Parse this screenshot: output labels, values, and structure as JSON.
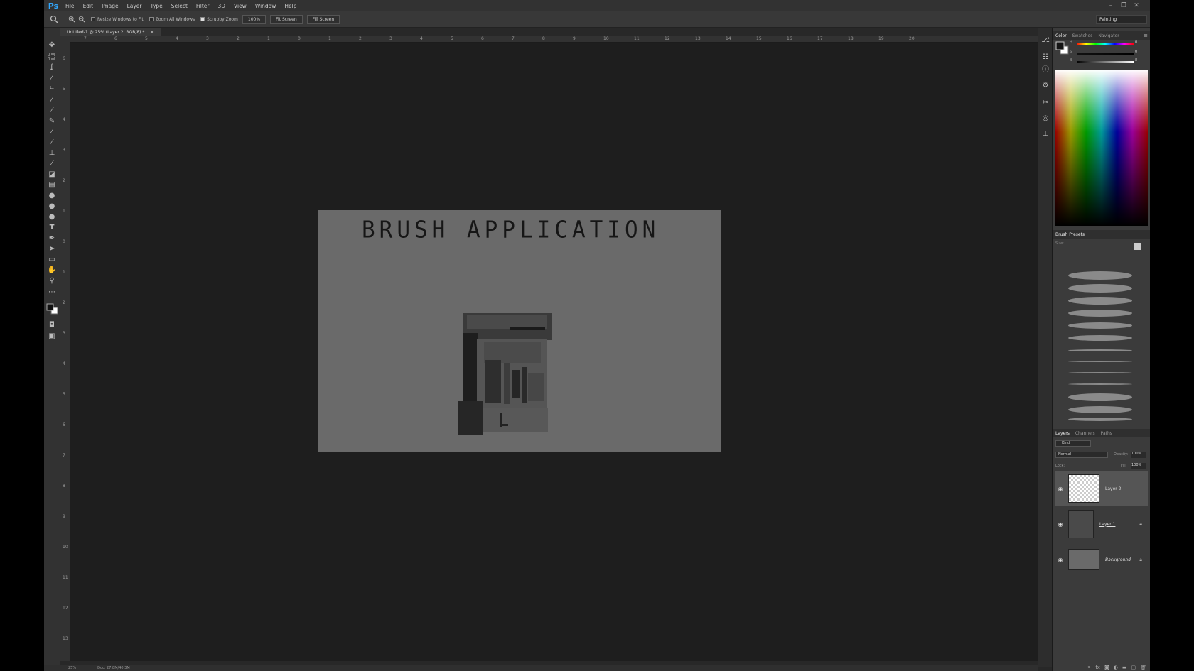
{
  "app": {
    "logo": "Ps"
  },
  "menu": [
    "File",
    "Edit",
    "Image",
    "Layer",
    "Type",
    "Select",
    "Filter",
    "3D",
    "View",
    "Window",
    "Help"
  ],
  "window_controls": {
    "minimize": "–",
    "restore": "❐",
    "close": "✕"
  },
  "options_bar": {
    "resize_windows_label": "Resize Windows to Fit",
    "resize_windows_checked": false,
    "zoom_all_label": "Zoom All Windows",
    "zoom_all_checked": false,
    "scrubby_zoom_label": "Scrubby Zoom",
    "scrubby_zoom_checked": true,
    "zoom_100_label": "100%",
    "fit_screen_label": "Fit Screen",
    "fill_screen_label": "Fill Screen",
    "workspace": "Painting"
  },
  "document_tab": {
    "title": "Untitled-1 @ 25% (Layer 2, RGB/8) *",
    "close": "×"
  },
  "ruler_top_labels": [
    "7",
    "6",
    "5",
    "4",
    "3",
    "2",
    "1",
    "0",
    "1",
    "2",
    "3",
    "4",
    "5",
    "6",
    "7",
    "8",
    "9",
    "10",
    "11",
    "12",
    "13",
    "14",
    "15",
    "16",
    "17",
    "18",
    "19",
    "20"
  ],
  "ruler_left_labels": [
    "6",
    "5",
    "4",
    "3",
    "2",
    "1",
    "0",
    "1",
    "2",
    "3",
    "4",
    "5",
    "6",
    "7",
    "8",
    "9",
    "10",
    "11",
    "12",
    "13"
  ],
  "canvas": {
    "title_text": "BRUSH APPLICATION"
  },
  "status": {
    "zoom": "25%",
    "doc_info": "Doc: 27.8M/40.3M"
  },
  "color_panel": {
    "tabs": [
      "Color",
      "Swatches",
      "Navigator"
    ],
    "active_tab": "Color",
    "sliders": [
      {
        "label": "H",
        "value": "0",
        "unit": "°"
      },
      {
        "label": "S",
        "value": "0",
        "unit": "%"
      },
      {
        "label": "B",
        "value": "8",
        "unit": "%"
      }
    ],
    "foreground": "#141414",
    "background": "#ffffff"
  },
  "brush_presets": {
    "title": "Brush Presets",
    "size_label": "Size:"
  },
  "layers_panel": {
    "tabs": [
      "Layers",
      "Channels",
      "Paths"
    ],
    "active_tab": "Layers",
    "filter_kind": "Kind",
    "blend_mode": "Normal",
    "opacity_label": "Opacity:",
    "opacity_value": "100%",
    "lock_label": "Lock:",
    "fill_label": "Fill:",
    "fill_value": "100%",
    "layers": [
      {
        "name": "Layer 2",
        "visible": true,
        "locked": false,
        "selected": true
      },
      {
        "name": "Layer 1",
        "visible": true,
        "locked": true,
        "selected": false
      },
      {
        "name": "Background",
        "visible": true,
        "locked": true,
        "selected": false
      }
    ]
  }
}
